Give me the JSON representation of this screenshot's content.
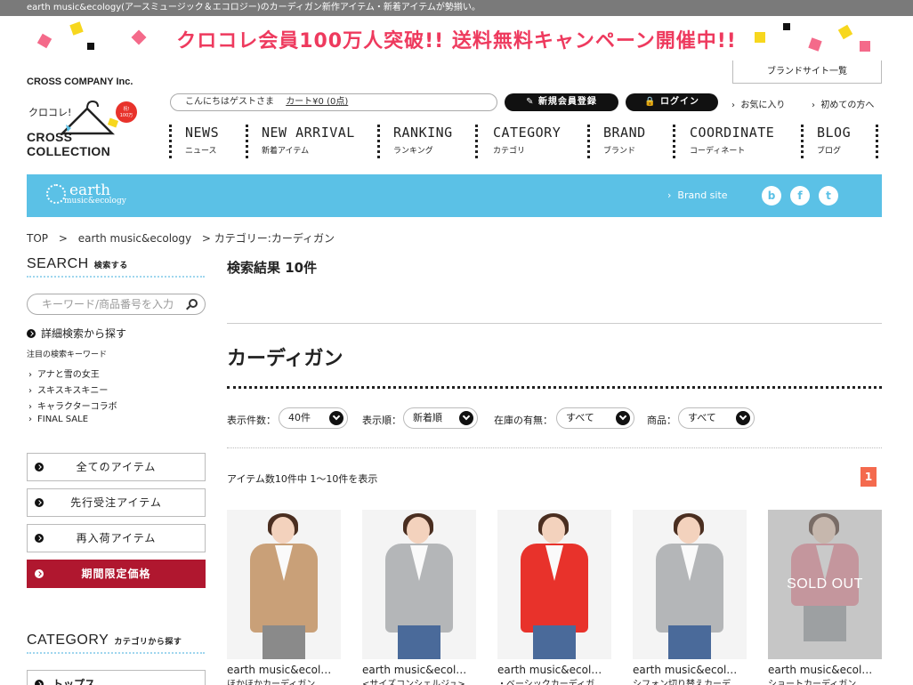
{
  "topbar": "earth music&ecology(アースミュージック＆エコロジー)のカーディガン新作アイテム・新着アイテムが勢揃い。",
  "campaign": "クロコレ会員100万人突破!! 送料無料キャンペーン開催中!!",
  "company": "CROSS COMPANY Inc.",
  "brand_list": "ブランドサイト一覧",
  "logo": {
    "title": "CROSS COLLECTION",
    "tag": "クロコレ!",
    "badge": "祝!100万突破"
  },
  "header": {
    "greeting": "こんにちはゲストさま",
    "cart": "カート¥0 (0点)",
    "register": "新規会員登録",
    "login": "ログイン",
    "favorites": "お気に入り",
    "first_time": "初めての方へ"
  },
  "nav": [
    {
      "en": "NEWS",
      "ja": "ニュース"
    },
    {
      "en": "NEW ARRIVAL",
      "ja": "新着アイテム"
    },
    {
      "en": "RANKING",
      "ja": "ランキング"
    },
    {
      "en": "CATEGORY",
      "ja": "カテゴリ"
    },
    {
      "en": "BRAND",
      "ja": "ブランド"
    },
    {
      "en": "COORDINATE",
      "ja": "コーディネート"
    },
    {
      "en": "BLOG",
      "ja": "ブログ"
    }
  ],
  "brandbar": {
    "name": "earth",
    "sub": "music&ecology",
    "site": "Brand site",
    "color": "#5bc1e6"
  },
  "breadcrumb": [
    "TOP",
    ">",
    "earth music&ecology",
    "> カテゴリー:カーディガン"
  ],
  "sidebar": {
    "search_title": "SEARCH",
    "search_sub": "検索する",
    "search_placeholder": "キーワード/商品番号を入力",
    "advanced": "詳細検索から探す",
    "keywords_title": "注目の検索キーワード",
    "keywords": [
      "アナと雪の女王",
      "スキスキスキニー",
      "キャラクターコラボ",
      "FINAL SALE"
    ],
    "buttons": [
      "全てのアイテム",
      "先行受注アイテム",
      "再入荷アイテム",
      "期間限定価格"
    ],
    "category_title": "CATEGORY",
    "category_sub": "カテゴリから探す",
    "category_first": "トップス"
  },
  "main": {
    "result": "検索結果 10件",
    "category_title": "カーディガン",
    "filters": [
      {
        "label": "表示件数：",
        "value": "40件"
      },
      {
        "label": "表示順：",
        "value": "新着順"
      },
      {
        "label": "在庫の有無：",
        "value": "すべて"
      },
      {
        "label": "商品：",
        "value": "すべて"
      }
    ],
    "count": "アイテム数10件中 1〜10件を表示",
    "page": "1"
  },
  "products": [
    {
      "brand": "earth music&ecol…",
      "name": "ほかほかカーディガン",
      "color": "#c9a078",
      "soldout": false
    },
    {
      "brand": "earth music&ecol…",
      "name": "<サイズコンシェルジュ>",
      "color": "#b4b6b8",
      "soldout": false
    },
    {
      "brand": "earth music&ecol…",
      "name": "・ベーシックカーディガ",
      "color": "#e8322b",
      "soldout": false
    },
    {
      "brand": "earth music&ecol…",
      "name": "シフォン切り替えカーデ",
      "color": "#b4b6b8",
      "soldout": false
    },
    {
      "brand": "earth music&ecol…",
      "name": "ショートカーディガン",
      "color": "#f08a9a",
      "soldout": true,
      "soldout_text": "SOLD OUT"
    }
  ]
}
